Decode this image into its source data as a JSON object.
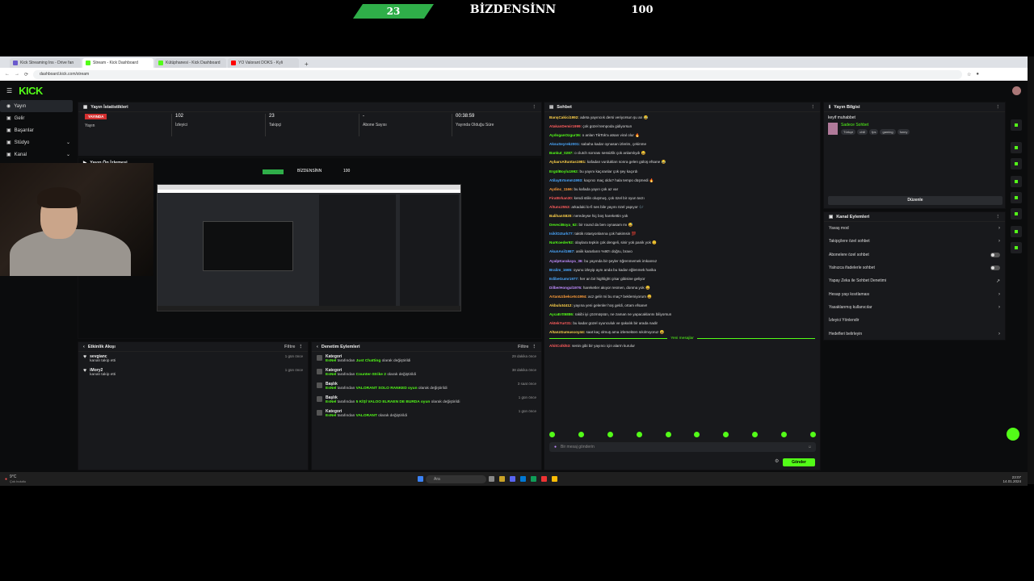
{
  "scoreboard": {
    "left": "23",
    "title": "BİZDENSİNN",
    "right": "100"
  },
  "browser": {
    "tabs": [
      {
        "label": "Kick Streaming Ins - Drive fan"
      },
      {
        "label": "Stream - Kick Dashboard"
      },
      {
        "label": "Kütüphanesi - Kick Dashboard"
      },
      {
        "label": "YO Valorant DOKS - Kyli"
      }
    ],
    "new_tab": "+",
    "url": "dashboard.kick.com/stream"
  },
  "site": {
    "logo": "KICK",
    "sidebar": [
      {
        "label": "Yayın",
        "chevron": ""
      },
      {
        "label": "Gelir",
        "chevron": ""
      },
      {
        "label": "Başarılar",
        "chevron": ""
      },
      {
        "label": "Stüdyo",
        "chevron": "⌄"
      },
      {
        "label": "Kanal",
        "chevron": "⌄"
      }
    ],
    "stats": {
      "title": "Yayın İstatistikleri",
      "live": "YAYINDA",
      "live_label": "Yayın",
      "viewers": "102",
      "viewers_label": "İzleyici",
      "followers": "23",
      "followers_label": "Takipçi",
      "subs": "-",
      "subs_label": "Abone Sayısı",
      "uptime": "00:38:59",
      "uptime_label": "Yayında Olduğu Süre"
    },
    "preview": {
      "title": "Yayın Ön İzlemesi",
      "mini_title": "BİZDENSİNN",
      "mini_score": "100"
    },
    "activity": {
      "title": "Etkinlik Akışı",
      "filter": "Filtre",
      "items": [
        {
          "name": "sevgianc",
          "text": "kanalı takip etti",
          "time": "1 gün önce"
        },
        {
          "name": "iMory2",
          "text": "kanalı takip etti",
          "time": "1 gün önce"
        }
      ]
    },
    "mod": {
      "title": "Denetim Eylemleri",
      "filter": "Filtre",
      "items": [
        {
          "title": "Kategori",
          "user": "EsNel",
          "mid": "tarafından",
          "value": "Just Chatting",
          "end": "olarak değiştirildi",
          "time": "29 dakika önce"
        },
        {
          "title": "Kategori",
          "user": "EsNel",
          "mid": "tarafından",
          "value": "Counter-Strike 2",
          "end": "olarak değiştirildi",
          "time": "38 dakika önce"
        },
        {
          "title": "Başlık",
          "user": "EsNel",
          "mid": "tarafından",
          "value": "VALORANT SOLO RANKED oyun",
          "end": "olarak değiştirildi",
          "time": "3 saat önce"
        },
        {
          "title": "Başlık",
          "user": "EsNel",
          "mid": "tarafından",
          "value": "5 KİŞİ VALOO ELRAEN DE BURDA oyun",
          "end": "olarak değiştirildi",
          "time": "1 gün önce"
        },
        {
          "title": "Kategori",
          "user": "EsNel",
          "mid": "tarafından",
          "value": "VALORANT",
          "end": "olarak değiştirildi",
          "time": "1 gün önce"
        }
      ]
    },
    "chat": {
      "title": "Sohbet",
      "messages": [
        {
          "user": "BarışCakici1992:",
          "color": "#ffd24a",
          "text": "adeta yayıncıık dersi veriyorsun şu an 😂"
        },
        {
          "user": "AtakanDemir1999:",
          "color": "#ff5d5d",
          "text": "çok güzel tempoda gidiyorsun"
        },
        {
          "user": "AydoganOzgur36:",
          "color": "#53fc18",
          "text": "o anları TikTok'a atsan viral olur 🔥"
        },
        {
          "user": "AksuSeyrek2001:",
          "color": "#4aa8ff",
          "text": "sabaha kadar oynasan izlerim, çekinme"
        },
        {
          "user": "Bankut_0287:",
          "color": "#53fc18",
          "text": "o clutch sonrası sessizlik çok anlamlıydı 😄"
        },
        {
          "user": "AybarsAltuntas1981:",
          "color": "#ffd24a",
          "text": "kafadan vurdukları sonra gelen gülüş efsane 😂"
        },
        {
          "user": "ErgülBoylu1992:",
          "color": "#53fc18",
          "text": "bu yayını kaçıranlar çok şey kaçırdı"
        },
        {
          "user": "AtilayErtomm1993:",
          "color": "#4aa8ff",
          "text": "kaçıncı maç oldu? hala tempo düşmedi 🔥"
        },
        {
          "user": "Aydinc_1166:",
          "color": "#ff9d3a",
          "text": "bu kafada yayın çok az var"
        },
        {
          "user": "FiratErkan30:",
          "color": "#ff5d5d",
          "text": "kendi stilin oluşmuş, çok özel bir oyun tarzı"
        },
        {
          "user": "Altunc2553:",
          "color": "#ff5d5d",
          "text": "arkadaki lo-fi ses bile yayını özel yapıyor 🎶"
        },
        {
          "user": "BalihanS820:",
          "color": "#ffd24a",
          "text": "neredeyse hiç boş harekettin yok"
        },
        {
          "user": "DeveciBoya_62:",
          "color": "#53fc18",
          "text": "bir round da ben oynasam mı 😅"
        },
        {
          "user": "IsiklOzturk77:",
          "color": "#4aa8ff",
          "text": "taktik rotasyonlarına çok hakimsin 💯"
        },
        {
          "user": "NurKoeder92:",
          "color": "#53fc18",
          "text": "olaylara tepkin çok dengeli, sinir yok panik yok 😊"
        },
        {
          "user": "AkunAsil1987:",
          "color": "#4aa8ff",
          "text": "aniik kararların %90'ı doğru, bravo"
        },
        {
          "user": "AyalpKarakaya_36:",
          "color": "#c08cff",
          "text": "bu yayında bir şeyler öğrenmemek imkansız"
        },
        {
          "user": "Bralim_1665:",
          "color": "#4aa8ff",
          "text": "oyunu izleyip aynı anda bu kadar eğlenmek harika"
        },
        {
          "user": "EdibeGumr1977:",
          "color": "#4aa8ff",
          "text": "her an bir highlight çıkar gibisine geliyor"
        },
        {
          "user": "DilberHongul1976:",
          "color": "#c08cff",
          "text": "hareketler akıyor resmen, donma yok 😀"
        },
        {
          "user": "ArtanUzbekceto1994:",
          "color": "#ff9d3a",
          "text": "acz gelir mi bu maç? beklemiyorum 😄"
        },
        {
          "user": "Akbulut4412:",
          "color": "#ffd24a",
          "text": "yayına yeni gelenler hoş geldi, ortam efsane!"
        },
        {
          "user": "AycaErtt6886:",
          "color": "#53fc18",
          "text": "rakibi iyi çözmüşsün, ne zaman ne yapacaklarını biliyorsun"
        },
        {
          "user": "AktekYurt31:",
          "color": "#ff5d5d",
          "text": "bu kadar güzel oyunculuk ve şakalık bir arada nadir"
        },
        {
          "user": "AltanzGumuscoy44:",
          "color": "#ffd24a",
          "text": "saat kaç olmuş ama izlemekten sıkılmıyoruz 😆"
        }
      ],
      "new_divider": "Yeni mesajlar",
      "new_messages": [
        {
          "user": "AhitColkl53:",
          "color": "#ff5d5d",
          "text": "senin gibi bir yayıncı için alarm kurulur"
        }
      ],
      "placeholder": "Bir mesaj gönderin",
      "send": "Gönder"
    },
    "info": {
      "title": "Yayın Bilgisi",
      "stream_title": "keyif muhabbet",
      "category": "Sadece Sohbet",
      "tags": [
        "Türkçe",
        "chill",
        "fps",
        "gaming",
        "funny"
      ],
      "edit": "Düzenle"
    },
    "channel": {
      "title": "Kanal Eylemleri",
      "rows": [
        {
          "label": "Yavaş mod",
          "ctrl": "›"
        },
        {
          "label": "Takipçilere özel sohbet",
          "ctrl": "›"
        },
        {
          "label": "Abonelere özel sohbet",
          "ctrl": "toggle"
        },
        {
          "label": "Yalnızca ifadelerle sohbet",
          "ctrl": "toggle"
        },
        {
          "label": "Yapay Zeka ile Sohbet Denetimi",
          "ctrl": "↗"
        },
        {
          "label": "Hesap yaşı kısıtlaması",
          "ctrl": "›"
        },
        {
          "label": "Yasaklanmış kullanıcılar",
          "ctrl": "›"
        },
        {
          "label": "İzleyici Yönlendir",
          "ctrl": ""
        },
        {
          "label": "Hedefleri belirleyin",
          "ctrl": "›"
        }
      ]
    }
  },
  "taskbar": {
    "weather": "9°C",
    "weather_sub": "Çok bulutlu",
    "search": "Ara",
    "time": "23:07",
    "date": "14.01.2024"
  }
}
